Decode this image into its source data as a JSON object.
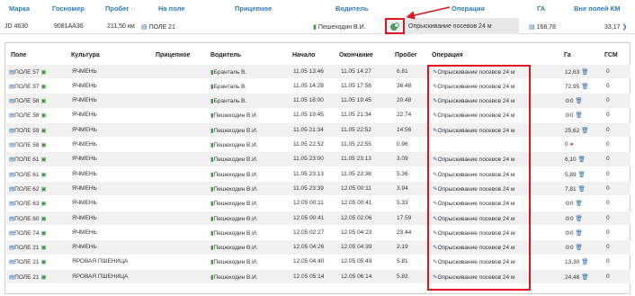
{
  "header": {
    "marka": "Марка",
    "gosnomer": "Госномер",
    "probeg": "Пробег",
    "na_pole": "На поле",
    "pricepnoe": "Прицепное",
    "voditel": "Водитель",
    "operaciya": "Операция",
    "ga": "ГА",
    "vne_poley": "Вне полей КМ"
  },
  "top_row": {
    "marka": "JD 4630",
    "gosnomer": "9081AA36",
    "probeg": "211,50 км",
    "na_pole": "ПОЛЕ 21",
    "voditel": "Пешеходин В.И.",
    "operaciya": "Опрыскивание посевов 24 м",
    "ga": "168,78",
    "vne_poley": "33,17"
  },
  "inner_header": {
    "pole": "Поле",
    "kultura": "Культура",
    "pricepnoe": "Прицепное",
    "voditel": "Водитель",
    "nachalo": "Начало",
    "okonchanie": "Окончание",
    "probeg": "Пробег",
    "operaciya": "Операция",
    "ga": "Га",
    "gsm": "ГСМ"
  },
  "rows": [
    {
      "pole": "ПОЛЕ 57",
      "kultura": "ЯЧМЕНЬ",
      "voditel": "Бранталь В.",
      "nachalo": "11.05 13:46",
      "okonchanie": "11.05 14:27",
      "probeg": "6.81",
      "operaciya": "Опрыскивание посевов 24 м",
      "ga": "12,63",
      "gsm": "0"
    },
    {
      "pole": "ПОЛЕ 57",
      "kultura": "ЯЧМЕНЬ",
      "voditel": "Бранталь В.",
      "nachalo": "11.05 14:28",
      "okonchanie": "11.05 17:56",
      "probeg": "36.48",
      "operaciya": "Опрыскивание посевов 24 м",
      "ga": "72,95",
      "gsm": "0"
    },
    {
      "pole": "ПОЛЕ 58",
      "kultura": "ЯЧМЕНЬ",
      "voditel": "Бранталь В.",
      "nachalo": "11.05 18:00",
      "okonchanie": "11.05 19:45",
      "probeg": "20.48",
      "operaciya": "Опрыскивание посевов 24 м",
      "ga": "0",
      "gsm": "0"
    },
    {
      "pole": "ПОЛЕ 58",
      "kultura": "ЯЧМЕНЬ",
      "voditel": "Пешеходин В.И.",
      "nachalo": "11.05 19:45",
      "okonchanie": "11.05 21:34",
      "probeg": "22.74",
      "operaciya": "Опрыскивание посевов 24 м",
      "ga": "0",
      "gsm": "0"
    },
    {
      "pole": "ПОЛЕ 59",
      "kultura": "ЯЧМЕНЬ",
      "voditel": "Пешеходин В.И.",
      "nachalo": "11.05 21:34",
      "okonchanie": "11.05 22:52",
      "probeg": "14.56",
      "operaciya": "Опрыскивание посевов 24 м",
      "ga": "25,62",
      "gsm": "0"
    },
    {
      "pole": "ПОЛЕ 58",
      "kultura": "ЯЧМЕНЬ",
      "voditel": "Пешеходин В.И.",
      "nachalo": "11.05 22:52",
      "okonchanie": "11.05 22:55",
      "probeg": "0.96",
      "operaciya": "",
      "ga": "0",
      "gsm": "0"
    },
    {
      "pole": "ПОЛЕ 61",
      "kultura": "ЯЧМЕНЬ",
      "voditel": "Пешеходин В.И.",
      "nachalo": "11.05 23:00",
      "okonchanie": "11.05 23:13",
      "probeg": "3.09",
      "operaciya": "Опрыскивание посевов 24 м",
      "ga": "6,10",
      "gsm": "0"
    },
    {
      "pole": "ПОЛЕ 61",
      "kultura": "ЯЧМЕНЬ",
      "voditel": "Пешеходин В.И.",
      "nachalo": "11.05 23:13",
      "okonchanie": "11.05 23:38",
      "probeg": "5.36",
      "operaciya": "Опрыскивание посевов 24 м",
      "ga": "5,89",
      "gsm": "0"
    },
    {
      "pole": "ПОЛЕ 62",
      "kultura": "ЯЧМЕНЬ",
      "voditel": "Пешеходин В.И.",
      "nachalo": "11.05 23:39",
      "okonchanie": "12.05 00:11",
      "probeg": "3.94",
      "operaciya": "Опрыскивание посевов 24 м",
      "ga": "7,81",
      "gsm": "0"
    },
    {
      "pole": "ПОЛЕ 63",
      "kultura": "ЯЧМЕНЬ",
      "voditel": "Пешеходин В.И.",
      "nachalo": "12.05 00:11",
      "okonchanie": "12.05 00:41",
      "probeg": "5.33",
      "operaciya": "Опрыскивание посевов 24 м",
      "ga": "0",
      "gsm": "0"
    },
    {
      "pole": "ПОЛЕ 60",
      "kultura": "ЯЧМЕНЬ",
      "voditel": "Пешеходин В.И.",
      "nachalo": "12.05 00:41",
      "okonchanie": "12.05 02:06",
      "probeg": "17.59",
      "operaciya": "Опрыскивание посевов 24 м",
      "ga": "0",
      "gsm": "0"
    },
    {
      "pole": "ПОЛЕ 74",
      "kultura": "ЯЧМЕНЬ",
      "voditel": "Пешеходин В.И.",
      "nachalo": "12.05 02:27",
      "okonchanie": "12.05 04:23",
      "probeg": "23.44",
      "operaciya": "Опрыскивание посевов 24 м",
      "ga": "0",
      "gsm": "0"
    },
    {
      "pole": "ПОЛЕ 21",
      "kultura": "ЯЧМЕНЬ",
      "voditel": "Пешеходин В.И.",
      "nachalo": "12.05 04:26",
      "okonchanie": "12.05 04:39",
      "probeg": "2.19",
      "operaciya": "Опрыскивание посевов 24 м",
      "ga": "0",
      "gsm": "0"
    },
    {
      "pole": "ПОЛЕ 21",
      "kultura": "ЯРОВАЯ ПШЕНИЦА",
      "voditel": "Пешеходин В.И.",
      "nachalo": "12.05 04:40",
      "okonchanie": "12.05 05:49",
      "probeg": "5.81",
      "operaciya": "Опрыскивание посевов 24 м",
      "ga": "13,30",
      "gsm": "0"
    },
    {
      "pole": "ПОЛЕ 21",
      "kultura": "ЯРОВАЯ ПШЕНИЦА",
      "voditel": "Пешеходин В.И.",
      "nachalo": "12.05 05:14",
      "okonchanie": "12.05 06:14",
      "probeg": "5.82",
      "operaciya": "Опрыскивание посевов 24 м",
      "ga": "24,48",
      "gsm": "0"
    }
  ],
  "colors": {
    "link": "#2a7ab8",
    "highlight": "#e0141e"
  }
}
